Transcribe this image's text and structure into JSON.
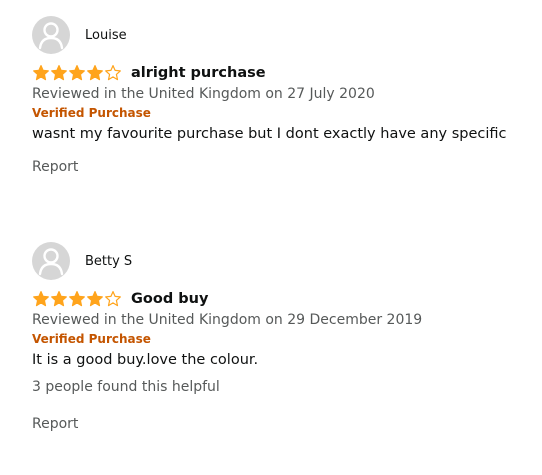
{
  "reviews": [
    {
      "profile_name": "Louise",
      "rating": 4,
      "rating_max": 5,
      "title": "alright purchase",
      "date_line": "Reviewed in the United Kingdom on 27 July 2020",
      "verified": "Verified Purchase",
      "body": "wasnt my favourite purchase but I dont exactly have any specific",
      "helpful": "",
      "report": "Report"
    },
    {
      "profile_name": "Betty S",
      "rating": 4,
      "rating_max": 5,
      "title": "Good buy",
      "date_line": "Reviewed in the United Kingdom on 29 December 2019",
      "verified": "Verified Purchase",
      "body": "It is a good buy.love the colour.",
      "helpful": "3 people found this helpful",
      "report": "Report"
    }
  ],
  "colors": {
    "star": "#ffa41c",
    "verified": "#c45500",
    "muted": "#565959",
    "text": "#0f1111",
    "avatar_bg": "#d6d6d6"
  }
}
